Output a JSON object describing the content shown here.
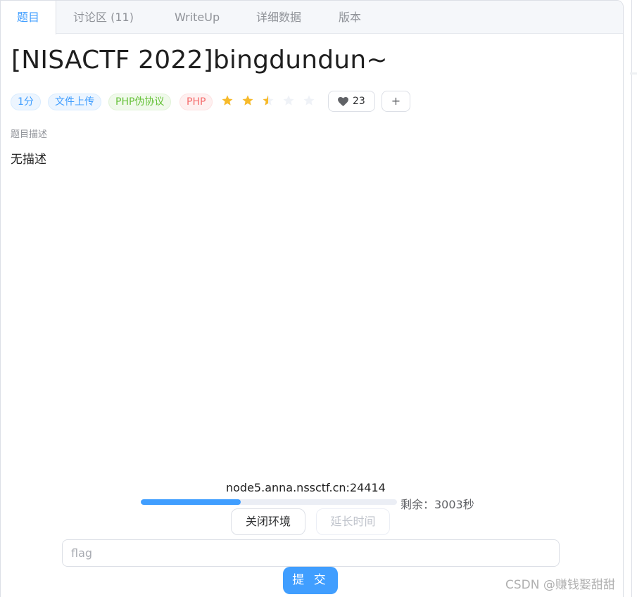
{
  "tabs": [
    {
      "label": "题目",
      "active": true
    },
    {
      "label": "讨论区 (11)",
      "active": false
    },
    {
      "label": "WriteUp",
      "active": false
    },
    {
      "label": "详细数据",
      "active": false
    },
    {
      "label": "版本",
      "active": false
    }
  ],
  "problem": {
    "title": "[NISACTF 2022]bingdundun~",
    "tags": [
      {
        "label": "1分",
        "color": "blue"
      },
      {
        "label": "文件上传",
        "color": "blue"
      },
      {
        "label": "PHP伪协议",
        "color": "green"
      },
      {
        "label": "PHP",
        "color": "red"
      }
    ],
    "rating": {
      "value": 2.5,
      "max": 5,
      "filled_color": "#f7ba2a",
      "empty_color": "#eff2f7"
    },
    "likes": "23",
    "like_icon": "heart-icon",
    "add_label": "+",
    "description_label": "题目描述",
    "description": "无描述"
  },
  "environment": {
    "address": "node5.anna.nssctf.cn:24414",
    "remaining_fraction": 0.39,
    "remaining_text": "剩余：3003秒",
    "close_label": "关闭环境",
    "extend_label": "延长时间"
  },
  "submit": {
    "placeholder": "flag",
    "value": "",
    "button_label": "提 交"
  },
  "watermark": "CSDN @赚钱娶甜甜",
  "colors": {
    "accent": "#409eff",
    "tab_bg": "#f5f7fa"
  }
}
